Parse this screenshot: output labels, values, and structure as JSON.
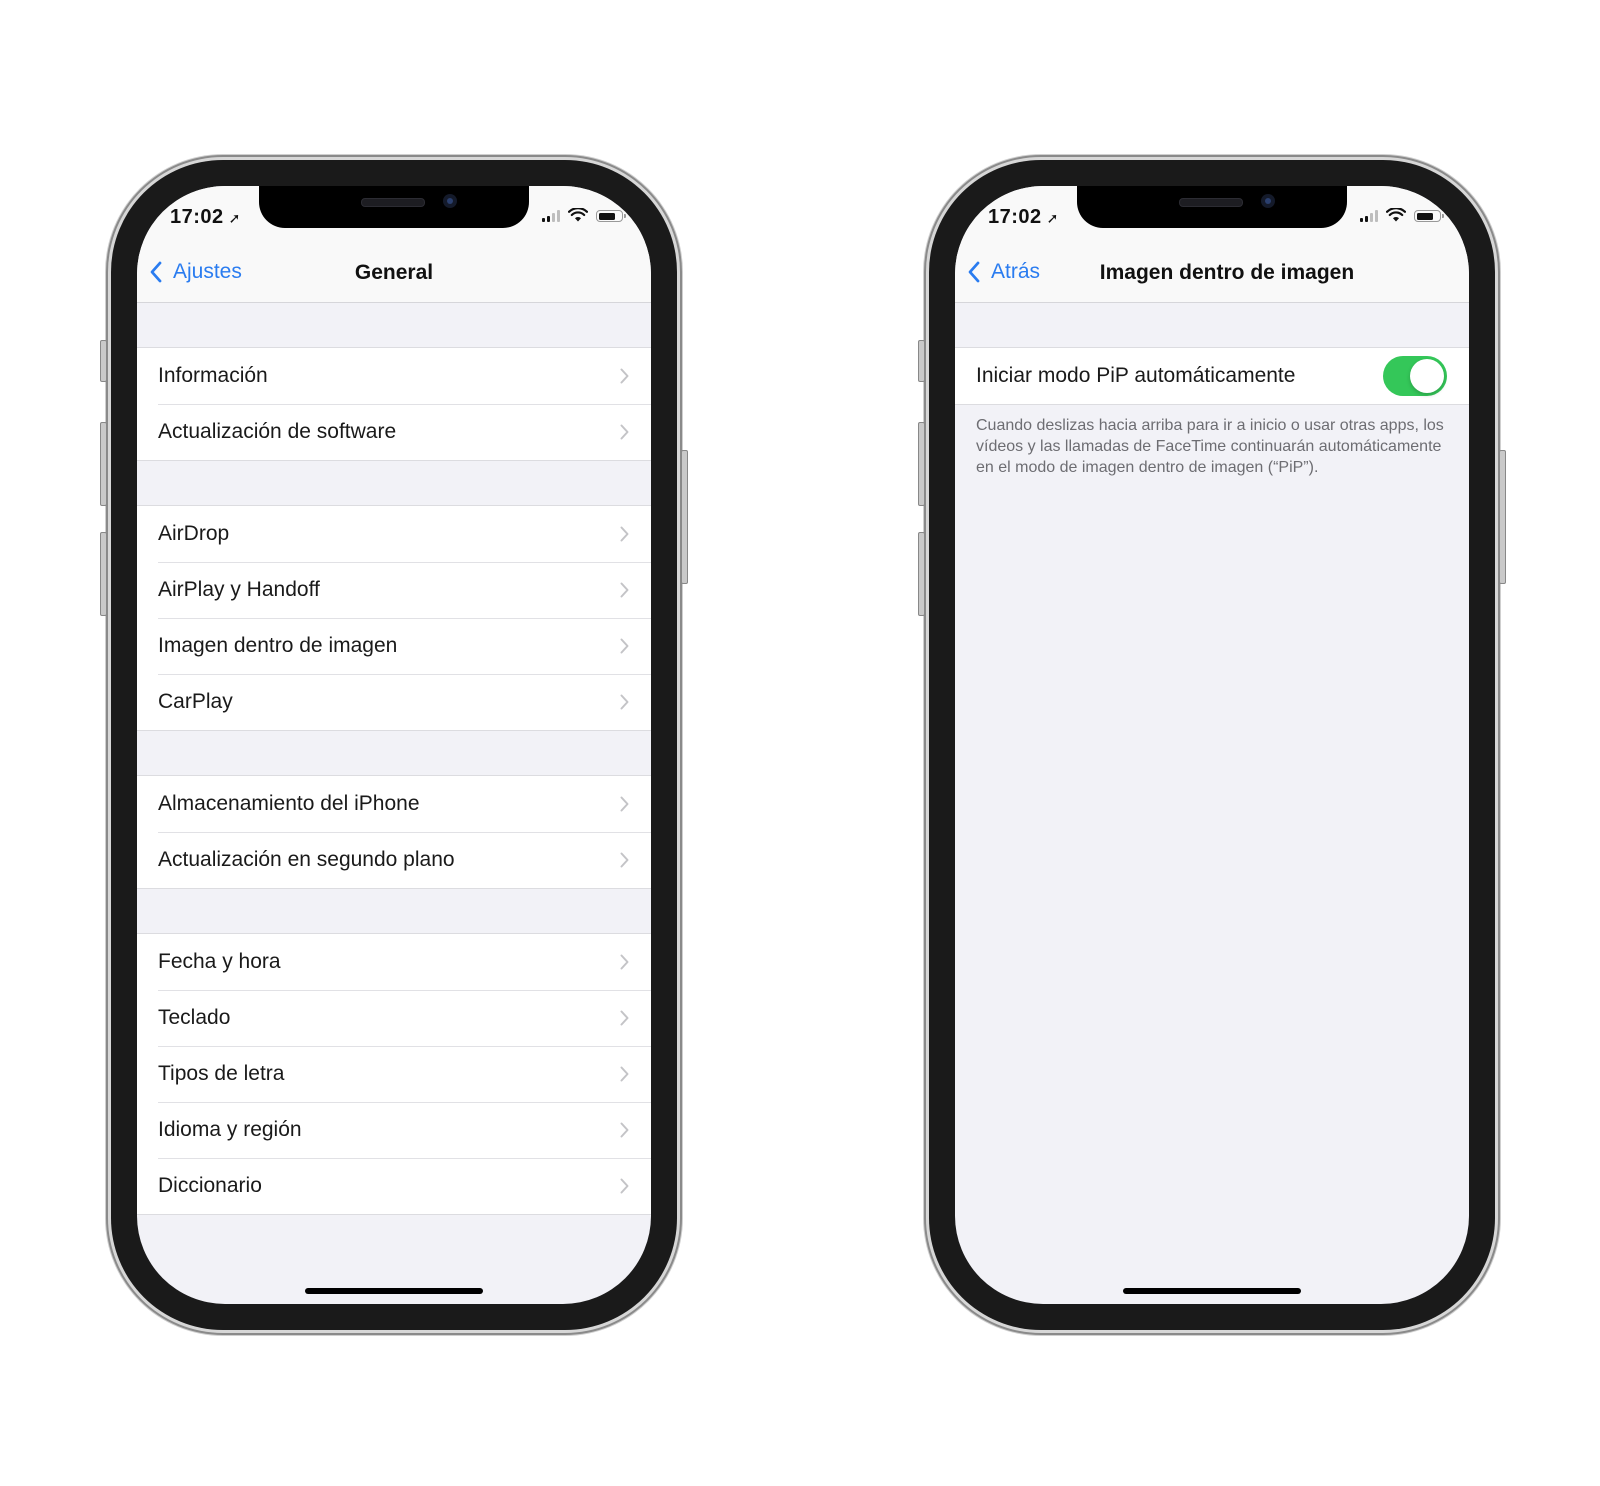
{
  "left_phone": {
    "status": {
      "time": "17:02",
      "location_icon": "location-arrow-icon",
      "signal_icon": "cellular-signal-icon",
      "wifi_icon": "wifi-icon",
      "battery_icon": "battery-icon"
    },
    "nav": {
      "back_label": "Ajustes",
      "title": "General"
    },
    "groups": [
      {
        "items": [
          {
            "label": "Información"
          },
          {
            "label": "Actualización de software"
          }
        ]
      },
      {
        "items": [
          {
            "label": "AirDrop"
          },
          {
            "label": "AirPlay y Handoff"
          },
          {
            "label": "Imagen dentro de imagen"
          },
          {
            "label": "CarPlay"
          }
        ]
      },
      {
        "items": [
          {
            "label": "Almacenamiento del iPhone"
          },
          {
            "label": "Actualización en segundo plano"
          }
        ]
      },
      {
        "items": [
          {
            "label": "Fecha y hora"
          },
          {
            "label": "Teclado"
          },
          {
            "label": "Tipos de letra"
          },
          {
            "label": "Idioma y región"
          },
          {
            "label": "Diccionario"
          }
        ]
      }
    ]
  },
  "right_phone": {
    "status": {
      "time": "17:02",
      "location_icon": "location-arrow-icon",
      "signal_icon": "cellular-signal-icon",
      "wifi_icon": "wifi-icon",
      "battery_icon": "battery-icon"
    },
    "nav": {
      "back_label": "Atrás",
      "title": "Imagen dentro de imagen"
    },
    "setting": {
      "label": "Iniciar modo PiP automáticamente",
      "enabled": true
    },
    "footer": "Cuando deslizas hacia arriba para ir a inicio o usar otras apps, los vídeos y las llamadas de FaceTime continuarán automáticamente en el modo de imagen dentro de imagen (“PiP”)."
  },
  "colors": {
    "accent": "#2a7cf0",
    "toggle_on": "#34c759",
    "background": "#f2f2f7"
  }
}
